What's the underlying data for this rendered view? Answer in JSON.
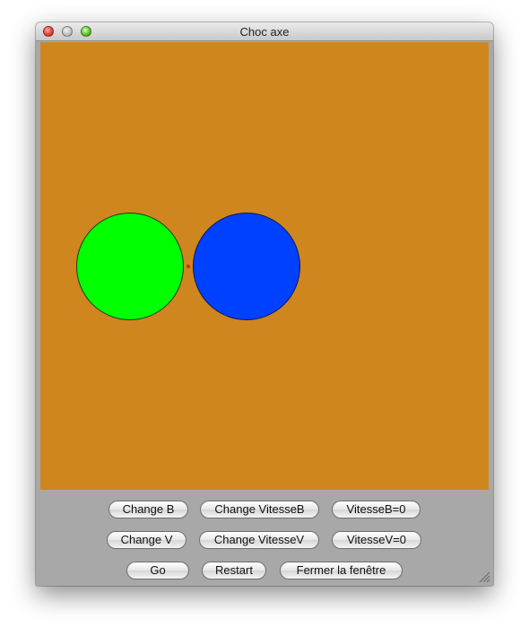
{
  "window": {
    "title": "Choc axe"
  },
  "canvas": {
    "background_color": "#cf861f",
    "balls": [
      {
        "name": "green",
        "color": "#00ff00"
      },
      {
        "name": "blue",
        "color": "#0040ff"
      }
    ]
  },
  "controls": {
    "row1": {
      "change_b": "Change B",
      "change_vitesse_b": "Change VitesseB",
      "vitesse_b_zero": "VitesseB=0"
    },
    "row2": {
      "change_v": "Change V",
      "change_vitesse_v": "Change VitesseV",
      "vitesse_v_zero": "VitesseV=0"
    },
    "row3": {
      "go": "Go",
      "restart": "Restart",
      "close_window": "Fermer la fenêtre"
    }
  }
}
